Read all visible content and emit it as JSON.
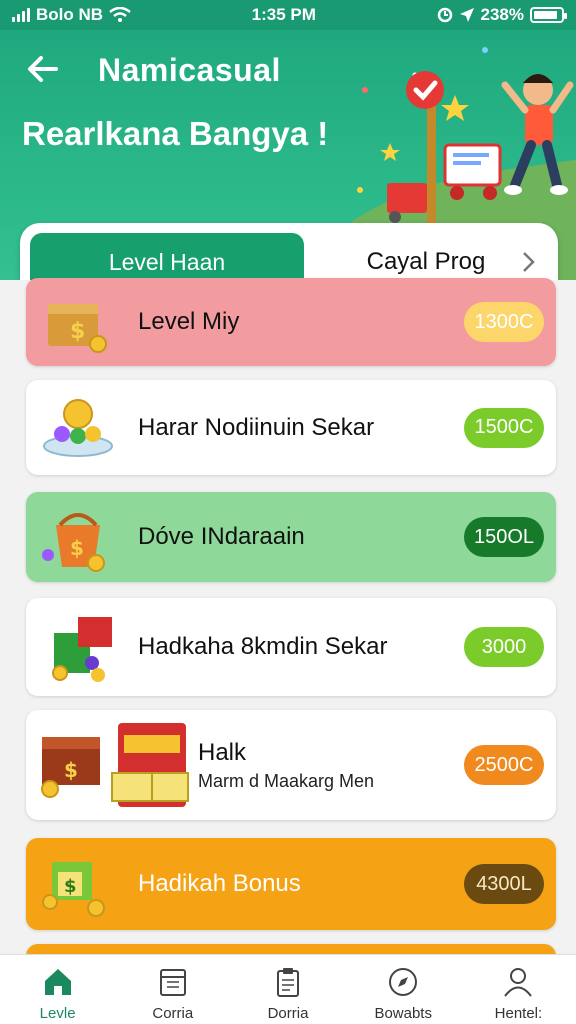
{
  "status_bar": {
    "carrier": "Bolo NB",
    "time": "1:35 PM",
    "battery": "238%"
  },
  "header": {
    "title": "Namicasual",
    "headline": "Rearlkana Bangya !"
  },
  "tabs": [
    {
      "label": "Level Haan",
      "active": true
    },
    {
      "label": "Cayal Prog",
      "active": false
    }
  ],
  "rewards": [
    {
      "title": "Level Miy",
      "subtitle": "",
      "value": "1300C",
      "bg": "#f29ca0",
      "pill": "#fcd66a",
      "icon": "treasure-chest-icon"
    },
    {
      "title": "Harar Nodiinuin Sekar",
      "subtitle": "",
      "value": "1500C",
      "bg": "#ffffff",
      "pill": "#7bcb2a",
      "icon": "coin-bowl-icon"
    },
    {
      "title": "Dóve INdaraain",
      "subtitle": "",
      "value": "150OL",
      "bg": "#8ed99a",
      "pill": "#177a2a",
      "icon": "coin-bucket-icon"
    },
    {
      "title": "Hadkaha 8kmdin Sekar",
      "subtitle": "",
      "value": "3000",
      "bg": "#ffffff",
      "pill": "#7bcb2a",
      "icon": "gift-box-icon"
    },
    {
      "title": "Halk",
      "subtitle": "Marm d Maakarg Men",
      "value": "2500C",
      "bg": "#ffffff",
      "pill": "#f08a1e",
      "icon": "prize-ticket-icon"
    },
    {
      "title": "Hadikah Bonus",
      "subtitle": "",
      "value": "4300L",
      "bg": "#f5a315",
      "pill": "#6a4a10",
      "icon": "cash-box-icon"
    }
  ],
  "bottom_nav": [
    {
      "label": "Levle",
      "icon": "home-icon",
      "active": true
    },
    {
      "label": "Corria",
      "icon": "calendar-icon",
      "active": false
    },
    {
      "label": "Dorria",
      "icon": "clipboard-icon",
      "active": false
    },
    {
      "label": "Bowabts",
      "icon": "compass-icon",
      "active": false
    },
    {
      "label": "Hentel:",
      "icon": "profile-icon",
      "active": false
    }
  ]
}
